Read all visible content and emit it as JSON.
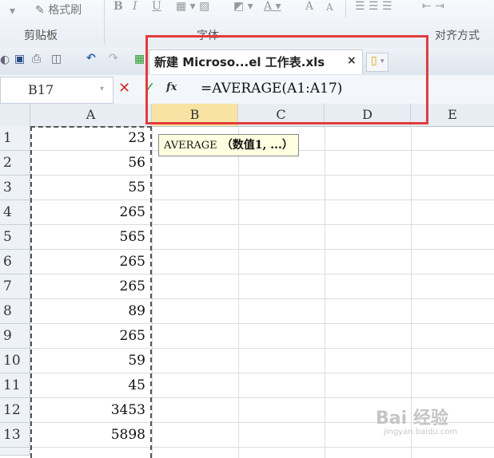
{
  "ribbon": {
    "format_painter": "格式刷",
    "font_glyphs": [
      "B",
      "I",
      "U"
    ],
    "font_size_glyphs": [
      "A",
      "A"
    ],
    "groups": {
      "clipboard": "剪贴板",
      "font": "字体",
      "alignment": "对齐方式"
    }
  },
  "tabs": {
    "document_title": "新建 Microso...el 工作表.xls",
    "close_glyph": "×"
  },
  "formula_bar": {
    "name_box": "B17",
    "formula": "=AVERAGE(A1:A17)",
    "fx_label": "fx"
  },
  "grid": {
    "columns": [
      "A",
      "B",
      "C",
      "D",
      "E"
    ],
    "active_column": "B",
    "rows": [
      {
        "row": "1",
        "a": "23"
      },
      {
        "row": "2",
        "a": "56"
      },
      {
        "row": "3",
        "a": "55"
      },
      {
        "row": "4",
        "a": "265"
      },
      {
        "row": "5",
        "a": "565"
      },
      {
        "row": "6",
        "a": "265"
      },
      {
        "row": "7",
        "a": "265"
      },
      {
        "row": "8",
        "a": "89"
      },
      {
        "row": "9",
        "a": "265"
      },
      {
        "row": "10",
        "a": "59"
      },
      {
        "row": "11",
        "a": "45"
      },
      {
        "row": "12",
        "a": "3453"
      },
      {
        "row": "13",
        "a": "5898"
      }
    ]
  },
  "tooltip": {
    "function_name": "AVERAGE",
    "args": "（数值1, ...）"
  },
  "watermark": {
    "main": "Bai 经验",
    "sub": "jingyan.baidu.com"
  },
  "colors": {
    "highlight_box": "#e23b3b",
    "active_header": "#f8e3a4",
    "cancel": "#d03030",
    "enter": "#2a9a2a"
  }
}
